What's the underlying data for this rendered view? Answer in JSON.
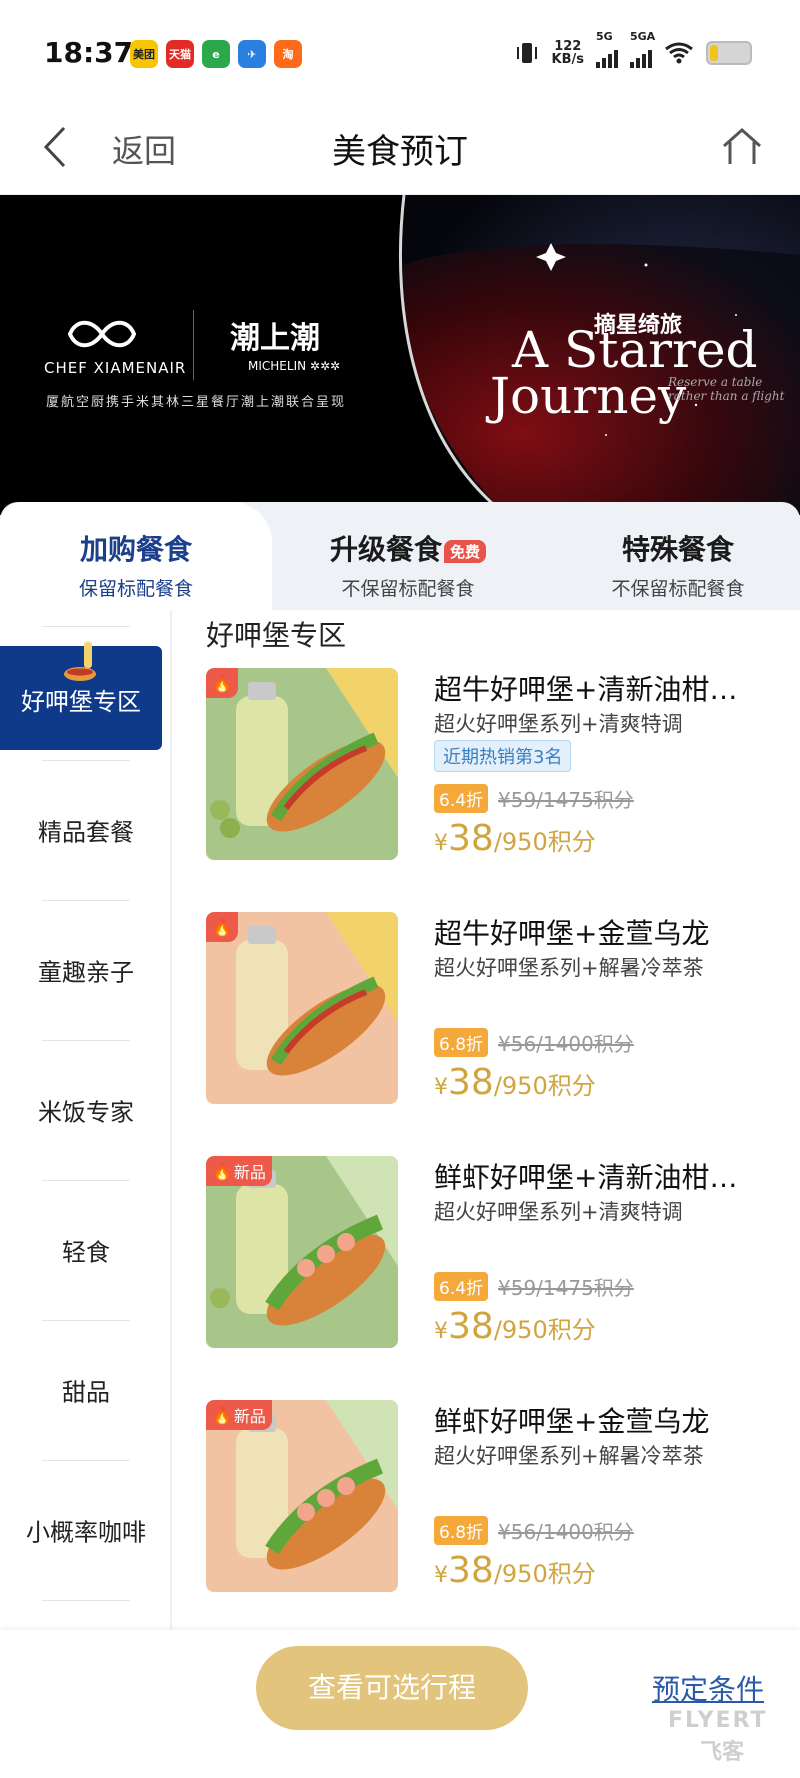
{
  "status_bar": {
    "time": "18:37",
    "apps": [
      {
        "label": "美团",
        "color": "#f7c600",
        "text_color": "#222"
      },
      {
        "label": "天猫",
        "color": "#e42a24",
        "text_color": "#fff"
      },
      {
        "label": "e",
        "color": "#2aa84a",
        "text_color": "#fff"
      },
      {
        "label": "✈",
        "color": "#2a7fe0",
        "text_color": "#fff"
      },
      {
        "label": "淘",
        "color": "#ff6a1a",
        "text_color": "#fff"
      }
    ],
    "net_speed_value": "122",
    "net_speed_unit": "KB/s",
    "signal_1": "5G",
    "signal_2": "5GA",
    "battery_level": 0.2
  },
  "nav": {
    "back_label": "返回",
    "title": "美食预订"
  },
  "banner": {
    "chef_brand": "CHEF XIAMENAIR",
    "restaurant_logo": "潮上潮",
    "michelin_label": "MICHELIN ✲✲✲",
    "subtitle": "厦航空厨携手米其林三星餐厅潮上潮联合呈现",
    "campaign_cn": "摘星绮旅",
    "campaign_en_line1": "A Starred",
    "campaign_en_line2": "Journey",
    "reserve_line1": "Reserve a table",
    "reserve_line2": "rather than a flight"
  },
  "tabs": [
    {
      "title": "加购餐食",
      "sub": "保留标配餐食"
    },
    {
      "title": "升级餐食",
      "badge": "免费",
      "sub": "不保留标配餐食"
    },
    {
      "title": "特殊餐食",
      "sub": "不保留标配餐食"
    }
  ],
  "sidebar": {
    "items": [
      "好呷堡专区",
      "精品套餐",
      "童趣亲子",
      "米饭专家",
      "轻食",
      "甜品",
      "小概率咖啡"
    ]
  },
  "section_title": "好呷堡专区",
  "products": [
    {
      "name": "超牛好呷堡+清新油柑…",
      "desc": "超火好呷堡系列+清爽特调",
      "tag": "近期热销第3名",
      "badge": "",
      "discount": "6.4折",
      "original": "¥59/1475积分",
      "currency": "¥",
      "price": "38",
      "points": "/950积分",
      "colors": [
        "#a8c68a",
        "#f1d36a"
      ]
    },
    {
      "name": "超牛好呷堡+金萱乌龙",
      "desc": "超火好呷堡系列+解暑冷萃茶",
      "tag": "",
      "badge": "",
      "discount": "6.8折",
      "original": "¥56/1400积分",
      "currency": "¥",
      "price": "38",
      "points": "/950积分",
      "colors": [
        "#f2c3a2",
        "#f1d36a"
      ]
    },
    {
      "name": "鲜虾好呷堡+清新油柑…",
      "desc": "超火好呷堡系列+清爽特调",
      "tag": "",
      "badge": "新品",
      "discount": "6.4折",
      "original": "¥59/1475积分",
      "currency": "¥",
      "price": "38",
      "points": "/950积分",
      "colors": [
        "#a8c68a",
        "#cfe3b4"
      ]
    },
    {
      "name": "鲜虾好呷堡+金萱乌龙",
      "desc": "超火好呷堡系列+解暑冷萃茶",
      "tag": "",
      "badge": "新品",
      "discount": "6.8折",
      "original": "¥56/1400积分",
      "currency": "¥",
      "price": "38",
      "points": "/950积分",
      "colors": [
        "#f2c3a2",
        "#cfe3b4"
      ]
    }
  ],
  "bottom": {
    "view_button": "查看可选行程",
    "conditions_link": "预定条件",
    "watermark_en": "FLYERT",
    "watermark_cn": "飞客"
  },
  "colors": {
    "primary": "#0f3a8a",
    "gold": "#d1a53e",
    "button": "#e2c47c",
    "discount": "#f5a93a",
    "hot": "#ee5a4a"
  }
}
